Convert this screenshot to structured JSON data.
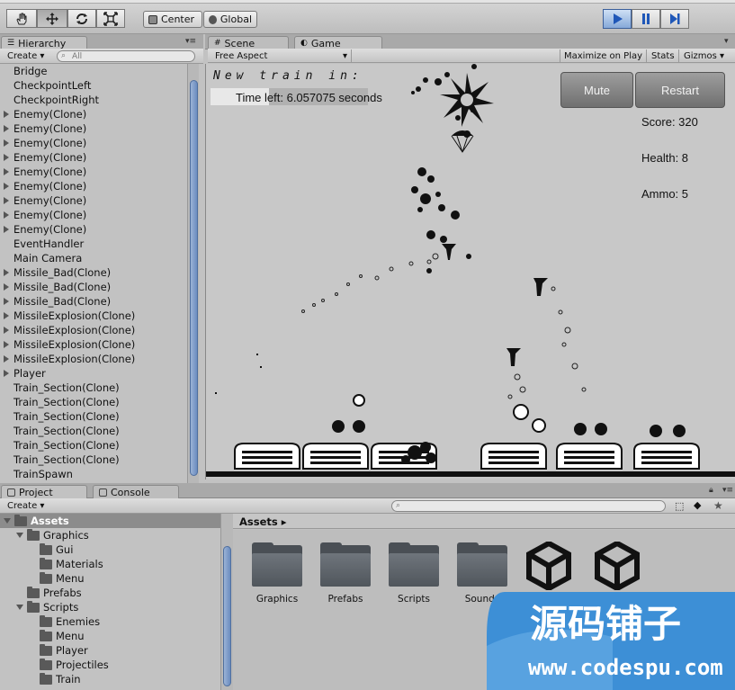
{
  "toolbar": {
    "tools": [
      "hand-tool",
      "move-tool",
      "rotate-tool",
      "scale-tool"
    ],
    "pivot_label": "Center",
    "space_label": "Global",
    "play_controls": [
      "play",
      "pause",
      "step"
    ]
  },
  "hierarchy": {
    "tab_label": "Hierarchy",
    "create_label": "Create",
    "search_placeholder": "All",
    "items": [
      {
        "label": "Bridge",
        "expandable": false
      },
      {
        "label": "CheckpointLeft",
        "expandable": false
      },
      {
        "label": "CheckpointRight",
        "expandable": false
      },
      {
        "label": "Enemy(Clone)",
        "expandable": true
      },
      {
        "label": "Enemy(Clone)",
        "expandable": true
      },
      {
        "label": "Enemy(Clone)",
        "expandable": true
      },
      {
        "label": "Enemy(Clone)",
        "expandable": true
      },
      {
        "label": "Enemy(Clone)",
        "expandable": true
      },
      {
        "label": "Enemy(Clone)",
        "expandable": true
      },
      {
        "label": "Enemy(Clone)",
        "expandable": true
      },
      {
        "label": "Enemy(Clone)",
        "expandable": true
      },
      {
        "label": "Enemy(Clone)",
        "expandable": true
      },
      {
        "label": "EventHandler",
        "expandable": false
      },
      {
        "label": "Main Camera",
        "expandable": false
      },
      {
        "label": "Missile_Bad(Clone)",
        "expandable": true
      },
      {
        "label": "Missile_Bad(Clone)",
        "expandable": true
      },
      {
        "label": "Missile_Bad(Clone)",
        "expandable": true
      },
      {
        "label": "MissileExplosion(Clone)",
        "expandable": true
      },
      {
        "label": "MissileExplosion(Clone)",
        "expandable": true
      },
      {
        "label": "MissileExplosion(Clone)",
        "expandable": true
      },
      {
        "label": "MissileExplosion(Clone)",
        "expandable": true
      },
      {
        "label": "Player",
        "expandable": true
      },
      {
        "label": "Train_Section(Clone)",
        "expandable": false
      },
      {
        "label": "Train_Section(Clone)",
        "expandable": false
      },
      {
        "label": "Train_Section(Clone)",
        "expandable": false
      },
      {
        "label": "Train_Section(Clone)",
        "expandable": false
      },
      {
        "label": "Train_Section(Clone)",
        "expandable": false
      },
      {
        "label": "Train_Section(Clone)",
        "expandable": false
      },
      {
        "label": "TrainSpawn",
        "expandable": false
      }
    ]
  },
  "view_tabs": {
    "scene_label": "Scene",
    "game_label": "Game"
  },
  "game_toolbar": {
    "aspect_label": "Free Aspect",
    "maximize_label": "Maximize on Play",
    "stats_label": "Stats",
    "gizmos_label": "Gizmos"
  },
  "game": {
    "banner": "New train in:",
    "time_left": "Time left: 6.057075 seconds",
    "time_progress_fraction": 0.37,
    "mute_label": "Mute",
    "restart_label": "Restart",
    "score": "Score: 320",
    "health": "Health: 8",
    "ammo": "Ammo: 5"
  },
  "bottom_tabs": {
    "project_label": "Project",
    "console_label": "Console",
    "create_label": "Create"
  },
  "project_tree": [
    {
      "label": "Assets",
      "depth": 0,
      "open": true,
      "selected": true
    },
    {
      "label": "Graphics",
      "depth": 1,
      "open": true,
      "selected": false
    },
    {
      "label": "Gui",
      "depth": 2,
      "open": false,
      "selected": false
    },
    {
      "label": "Materials",
      "depth": 2,
      "open": false,
      "selected": false
    },
    {
      "label": "Menu",
      "depth": 2,
      "open": false,
      "selected": false
    },
    {
      "label": "Prefabs",
      "depth": 1,
      "open": false,
      "selected": false
    },
    {
      "label": "Scripts",
      "depth": 1,
      "open": true,
      "selected": false
    },
    {
      "label": "Enemies",
      "depth": 2,
      "open": false,
      "selected": false
    },
    {
      "label": "Menu",
      "depth": 2,
      "open": false,
      "selected": false
    },
    {
      "label": "Player",
      "depth": 2,
      "open": false,
      "selected": false
    },
    {
      "label": "Projectiles",
      "depth": 2,
      "open": false,
      "selected": false
    },
    {
      "label": "Train",
      "depth": 2,
      "open": false,
      "selected": false
    }
  ],
  "assets_panel": {
    "breadcrumb": "Assets ▸",
    "folders": [
      "Graphics",
      "Prefabs",
      "Scripts",
      "Sounds"
    ],
    "unity_assets": [
      "unity-scene-asset",
      "unity-scene-asset"
    ]
  },
  "watermark": {
    "title": "源码铺子",
    "url": "www.codespu.com"
  },
  "colors": {
    "accent_blue": "#4a6fb0",
    "selection_gray": "#8c8c8c",
    "watermark_blue": "#3d8fd6"
  }
}
